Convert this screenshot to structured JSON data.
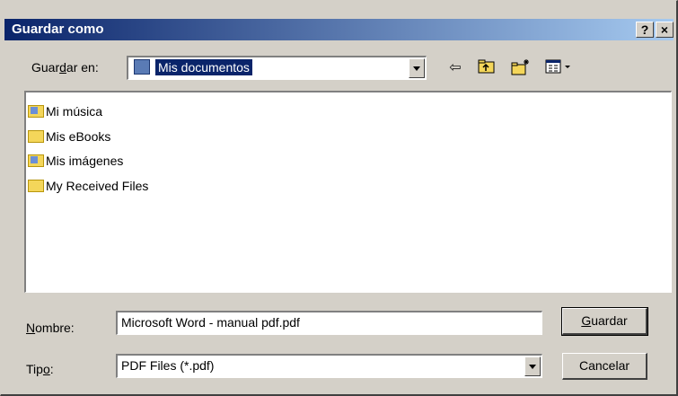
{
  "window": {
    "title": "Guardar como"
  },
  "titlebar": {
    "help_label": "?",
    "close_label": "×"
  },
  "save_in": {
    "label_pre": "Guar",
    "label_hot": "d",
    "label_post": "ar en:",
    "value": "Mis documentos"
  },
  "toolbar": {
    "icons": [
      "back-arrow-icon",
      "up-folder-icon",
      "new-folder-icon",
      "view-menu-icon"
    ]
  },
  "files": [
    {
      "name": "Mi música",
      "icon": "music-folder-icon"
    },
    {
      "name": "Mis eBooks",
      "icon": "folder-icon"
    },
    {
      "name": "Mis imágenes",
      "icon": "pictures-folder-icon"
    },
    {
      "name": "My Received Files",
      "icon": "folder-icon"
    }
  ],
  "name_field": {
    "label_hot": "N",
    "label_post": "ombre:",
    "value": "Microsoft Word - manual pdf.pdf"
  },
  "type_field": {
    "label_pre": "Tip",
    "label_hot": "o",
    "label_post": ":",
    "value": "PDF Files (*.pdf)"
  },
  "buttons": {
    "save_hot": "G",
    "save_post": "uardar",
    "cancel": "Cancelar"
  }
}
